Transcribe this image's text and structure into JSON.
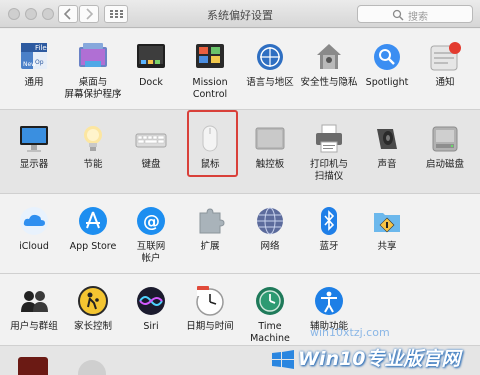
{
  "window": {
    "title": "系统偏好设置"
  },
  "search": {
    "placeholder": "搜索"
  },
  "rows": [
    {
      "items": [
        {
          "label": "通用",
          "icon": "general-icon"
        },
        {
          "label": "桌面与\n屏幕保护程序",
          "icon": "desktop-screensaver-icon"
        },
        {
          "label": "Dock",
          "icon": "dock-icon"
        },
        {
          "label": "Mission\nControl",
          "icon": "mission-control-icon"
        },
        {
          "label": "语言与地区",
          "icon": "language-region-icon"
        },
        {
          "label": "安全性与隐私",
          "icon": "security-privacy-icon"
        },
        {
          "label": "Spotlight",
          "icon": "spotlight-icon"
        },
        {
          "label": "通知",
          "icon": "notifications-icon"
        }
      ]
    },
    {
      "items": [
        {
          "label": "显示器",
          "icon": "displays-icon"
        },
        {
          "label": "节能",
          "icon": "energy-saver-icon"
        },
        {
          "label": "键盘",
          "icon": "keyboard-icon"
        },
        {
          "label": "鼠标",
          "icon": "mouse-icon"
        },
        {
          "label": "触控板",
          "icon": "trackpad-icon"
        },
        {
          "label": "打印机与\n扫描仪",
          "icon": "printers-scanners-icon"
        },
        {
          "label": "声音",
          "icon": "sound-icon"
        },
        {
          "label": "启动磁盘",
          "icon": "startup-disk-icon"
        }
      ]
    },
    {
      "items": [
        {
          "label": "iCloud",
          "icon": "icloud-icon"
        },
        {
          "label": "App Store",
          "icon": "app-store-icon"
        },
        {
          "label": "互联网\n帐户",
          "icon": "internet-accounts-icon"
        },
        {
          "label": "扩展",
          "icon": "extensions-icon"
        },
        {
          "label": "网络",
          "icon": "network-icon"
        },
        {
          "label": "蓝牙",
          "icon": "bluetooth-icon"
        },
        {
          "label": "共享",
          "icon": "sharing-icon"
        }
      ]
    },
    {
      "items": [
        {
          "label": "用户与群组",
          "icon": "users-groups-icon"
        },
        {
          "label": "家长控制",
          "icon": "parental-controls-icon"
        },
        {
          "label": "Siri",
          "icon": "siri-icon"
        },
        {
          "label": "日期与时间",
          "icon": "date-time-icon"
        },
        {
          "label": "Time Machine",
          "icon": "time-machine-icon"
        },
        {
          "label": "辅助功能",
          "icon": "accessibility-icon"
        }
      ]
    }
  ],
  "selected_item": "鼠标",
  "watermark": {
    "url": "win10xtzj.com",
    "brand": "Win10专业版官网"
  },
  "colors": {
    "selection": "#d9403a",
    "accent": "#2d7ff2"
  }
}
